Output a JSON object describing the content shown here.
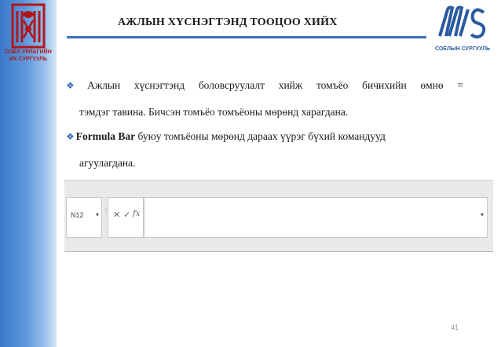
{
  "slide": {
    "title": "АЖЛЫН ХҮСНЭГТЭНД ТООЦОО ХИЙХ",
    "page_number": "41"
  },
  "logos": {
    "left_label_1": "СОЁЛ УРЛАГИЙН",
    "left_label_2": "ИХ СУРГУУЛЬ",
    "right_label": "СОЁЛЫН СУРГУУЛЬ"
  },
  "bullets": [
    {
      "mark": "❖",
      "line1": "Ажлын хүснэгтэнд боловсруулалт хийж томъёо бичихийн өмнө =",
      "line2": "тэмдэг тавина. Бичсэн томъёо томъёоны мөрөнд харагдана."
    },
    {
      "mark": "❖",
      "bold": "Formula Bar",
      "line1_rest": " буюу томъёоны мөрөнд дараах үүрэг бүхий командууд",
      "line2": "агуулагдана."
    }
  ],
  "formula_bar": {
    "name_box_value": "N12",
    "dropdown_glyph": "▾",
    "cancel_glyph": "✕",
    "enter_glyph": "✓",
    "function_glyph": "fx",
    "separator_glyph": "⋮"
  },
  "colors": {
    "left_band": "#3a78c8",
    "title_rule": "#3c6fb8",
    "left_logo": "#b01818",
    "right_logo": "#2a5aa0",
    "bullet_mark": "#2f6db5"
  }
}
